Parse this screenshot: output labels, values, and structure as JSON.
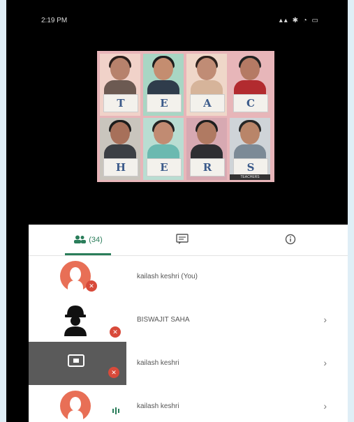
{
  "status_bar": {
    "time": "2:19 PM",
    "right_icons": "▴▴ ✱ ◔ ▭"
  },
  "shared_screen": {
    "tiles": [
      {
        "letter": "T"
      },
      {
        "letter": "E"
      },
      {
        "letter": "A"
      },
      {
        "letter": "C"
      },
      {
        "letter": "H"
      },
      {
        "letter": "E"
      },
      {
        "letter": "R"
      },
      {
        "letter": "S"
      }
    ],
    "caption": "TEACHERS"
  },
  "tabs": {
    "people_count": "(34)"
  },
  "participants": [
    {
      "name": "kailash keshri (You)"
    },
    {
      "name": "BISWAJIT SAHA"
    },
    {
      "name": "kailash keshri"
    },
    {
      "name": "kailash keshri"
    }
  ],
  "colors": {
    "accent": "#2a7d5a",
    "mute_badge": "#d84a3a",
    "avatar": "#e86f56"
  }
}
